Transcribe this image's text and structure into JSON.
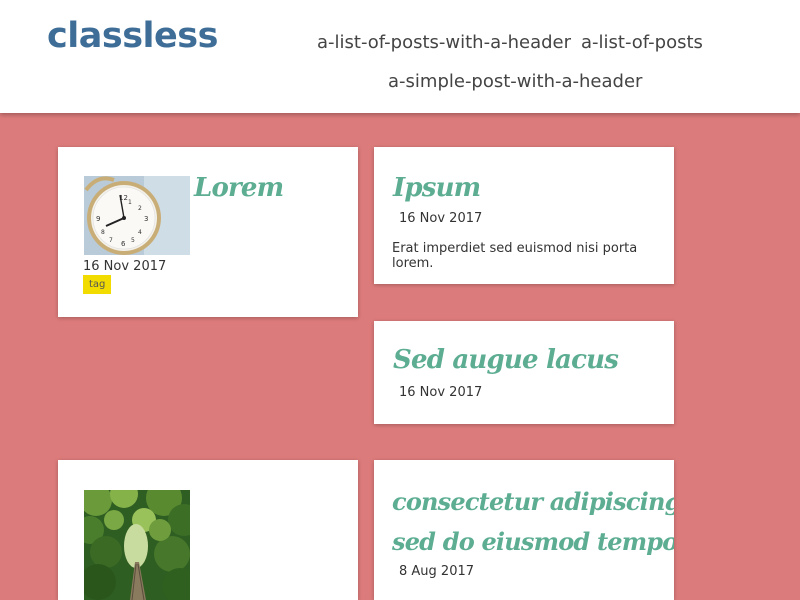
{
  "site": {
    "title": "classless"
  },
  "nav": {
    "items": [
      {
        "label": "a-list-of-posts-with-a-header"
      },
      {
        "label": "a-list-of-posts"
      },
      {
        "label": "a-simple-post-with-a-header"
      }
    ]
  },
  "posts": [
    {
      "title": "Lorem",
      "date": "16 Nov 2017",
      "tag": "tag",
      "image": "alarm-clock-photo"
    },
    {
      "title": "Ipsum",
      "date": "16 Nov 2017",
      "excerpt": "Erat imperdiet sed euismod nisi porta lorem."
    },
    {
      "title": "Sed augue lacus",
      "date": "16 Nov 2017"
    },
    {
      "title": "",
      "image": "forest-railway-photo"
    },
    {
      "title_line1": "consectetur adipiscing elit,",
      "title_line2": "sed do eiusmod tempor",
      "date": "8 Aug 2017"
    }
  ],
  "colors": {
    "background": "#dc7b7b",
    "header": "#ffffff",
    "brand": "#3e6e98",
    "post_title": "#5cad92",
    "tag": "#f2dc00"
  }
}
